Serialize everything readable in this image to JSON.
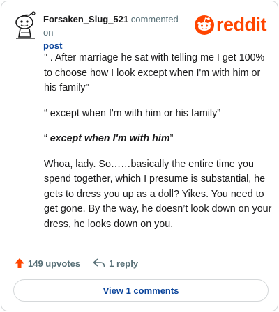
{
  "header": {
    "username": "Forsaken_Slug_521",
    "action": "commented on",
    "target": "post",
    "logo_text": "reddit"
  },
  "comment": {
    "paragraphs": [
      "” . After marriage he sat with telling me I get 100% to choose how I look except when I'm with him or his family”",
      "“ except when I'm with him or his family”",
      "Whoa, lady. So……basically the entire time you spend together, which I presume is substantial, he gets to dress you up as a doll? Yikes. You need to get gone. By the way, he doesn’t look down on your dress, he looks down on you."
    ],
    "emphasis": {
      "open_quote": "“ ",
      "text": "except when I'm with him",
      "close_quote": "”"
    }
  },
  "actions": {
    "upvotes": "149 upvotes",
    "replies": "1 reply"
  },
  "view_comments_label": "View 1 comments",
  "colors": {
    "brand": "#ff4500",
    "link": "#0a449b",
    "muted": "#576f76",
    "border": "#d5d8da"
  },
  "icons": [
    "snoo-avatar-icon",
    "reddit-logo-icon",
    "upvote-arrow-icon",
    "reply-arrow-icon"
  ]
}
